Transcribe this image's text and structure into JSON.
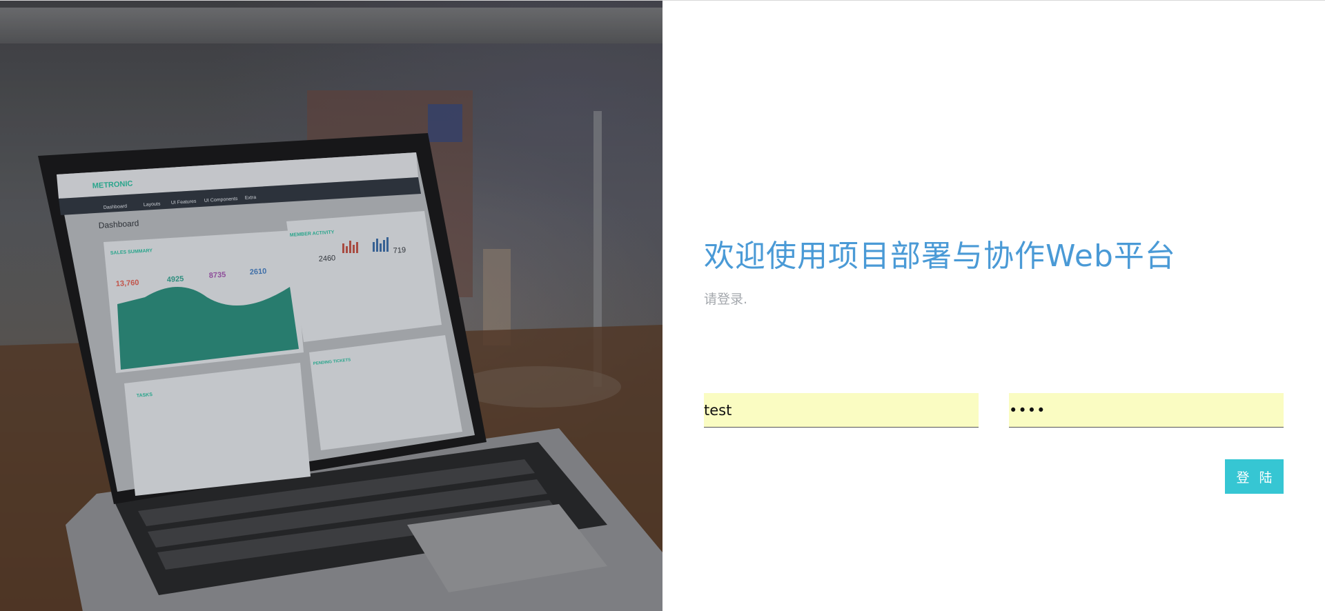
{
  "login": {
    "title": "欢迎使用项目部署与协作Web平台",
    "subtitle": "请登录.",
    "username_value": "test",
    "password_value": "••••",
    "submit_label": "登 陆"
  },
  "photo": {
    "brand": "METRONIC",
    "nav_items": [
      "Dashboard",
      "Layouts",
      "UI Features",
      "UI Components",
      "Extra"
    ],
    "page_title": "Dashboard",
    "sales_summary_title": "SALES SUMMARY",
    "sales_summary_values": [
      "13,760",
      "4925",
      "8735",
      "2610"
    ],
    "member_activity_title": "MEMBER ACTIVITY",
    "member_activity_values": [
      "2460",
      "719"
    ],
    "tasks_title": "TASKS",
    "pending_tickets_title": "PENDING TICKETS"
  },
  "colors": {
    "title": "#4a9ad6",
    "subtitle": "#a4a8ad",
    "field_bg": "#fafcc2",
    "button_bg": "#36c6d3",
    "brand_teal": "#2aa58c"
  }
}
